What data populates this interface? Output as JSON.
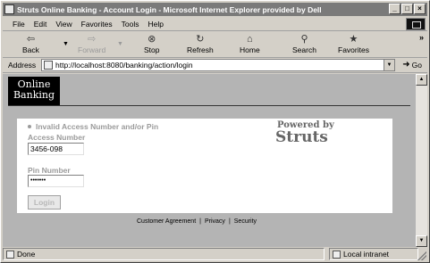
{
  "window": {
    "title": "Struts Online Banking - Account Login - Microsoft Internet Explorer provided by Dell",
    "minimize": "_",
    "maximize": "□",
    "close": "×"
  },
  "menu": [
    "File",
    "Edit",
    "View",
    "Favorites",
    "Tools",
    "Help"
  ],
  "toolbar": {
    "back": "Back",
    "forward": "Forward",
    "stop": "Stop",
    "refresh": "Refresh",
    "home": "Home",
    "search": "Search",
    "favorites": "Favorites",
    "more": "»"
  },
  "address": {
    "label": "Address",
    "url": "http://localhost:8080/banking/action/login",
    "go": "Go"
  },
  "page": {
    "banner_line1": "Online",
    "banner_line2": "Banking",
    "error": "Invalid Access Number and/or Pin",
    "access_label": "Access Number",
    "access_value": "3456-098",
    "pin_label": "Pin Number",
    "pin_value": "•••••••",
    "login_button": "Login",
    "powered_by": "Powered by",
    "powered_name": "Struts",
    "footer": {
      "agreement": "Customer Agreement",
      "sep1": "|",
      "privacy": "Privacy",
      "sep2": "|",
      "security": "Security"
    }
  },
  "status": {
    "text": "Done",
    "zone": "Local intranet"
  }
}
